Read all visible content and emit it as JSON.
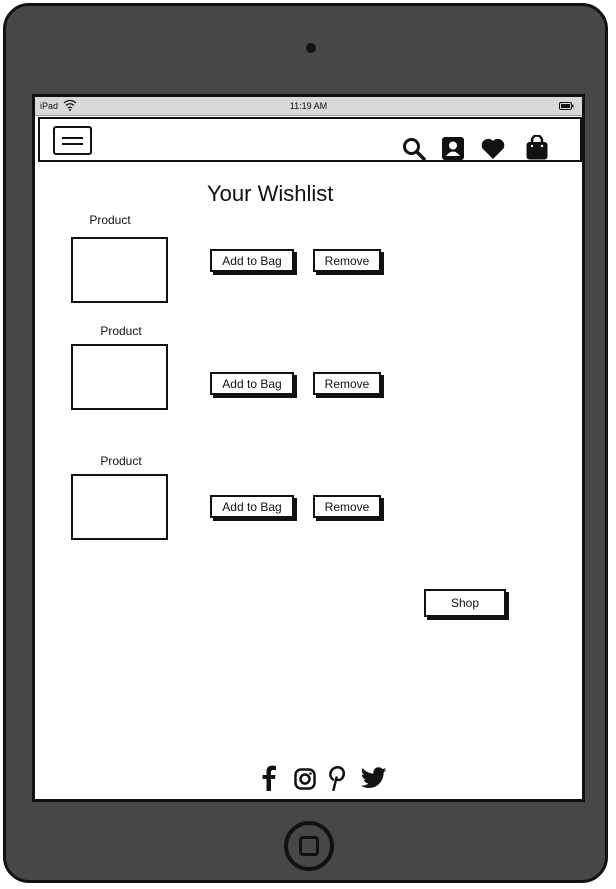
{
  "status_bar": {
    "device": "iPad",
    "time": "11:19 AM"
  },
  "header": {
    "menu_icon": "hamburger-menu-icon",
    "icons": [
      "search-icon",
      "account-icon",
      "heart-icon",
      "shopping-bag-icon"
    ]
  },
  "page": {
    "title": "Your Wishlist"
  },
  "wishlist": {
    "items": [
      {
        "label": "Product",
        "add_label": "Add to Bag",
        "remove_label": "Remove"
      },
      {
        "label": "Product",
        "add_label": "Add to Bag",
        "remove_label": "Remove"
      },
      {
        "label": "Product",
        "add_label": "Add to Bag",
        "remove_label": "Remove"
      }
    ]
  },
  "shop_button": "Shop",
  "footer": {
    "social_icons": [
      "facebook-icon",
      "instagram-icon",
      "pinterest-icon",
      "twitter-icon"
    ]
  },
  "colors": {
    "device_body": "#474747",
    "status_bar": "#d9d9d9",
    "ink": "#111111"
  }
}
